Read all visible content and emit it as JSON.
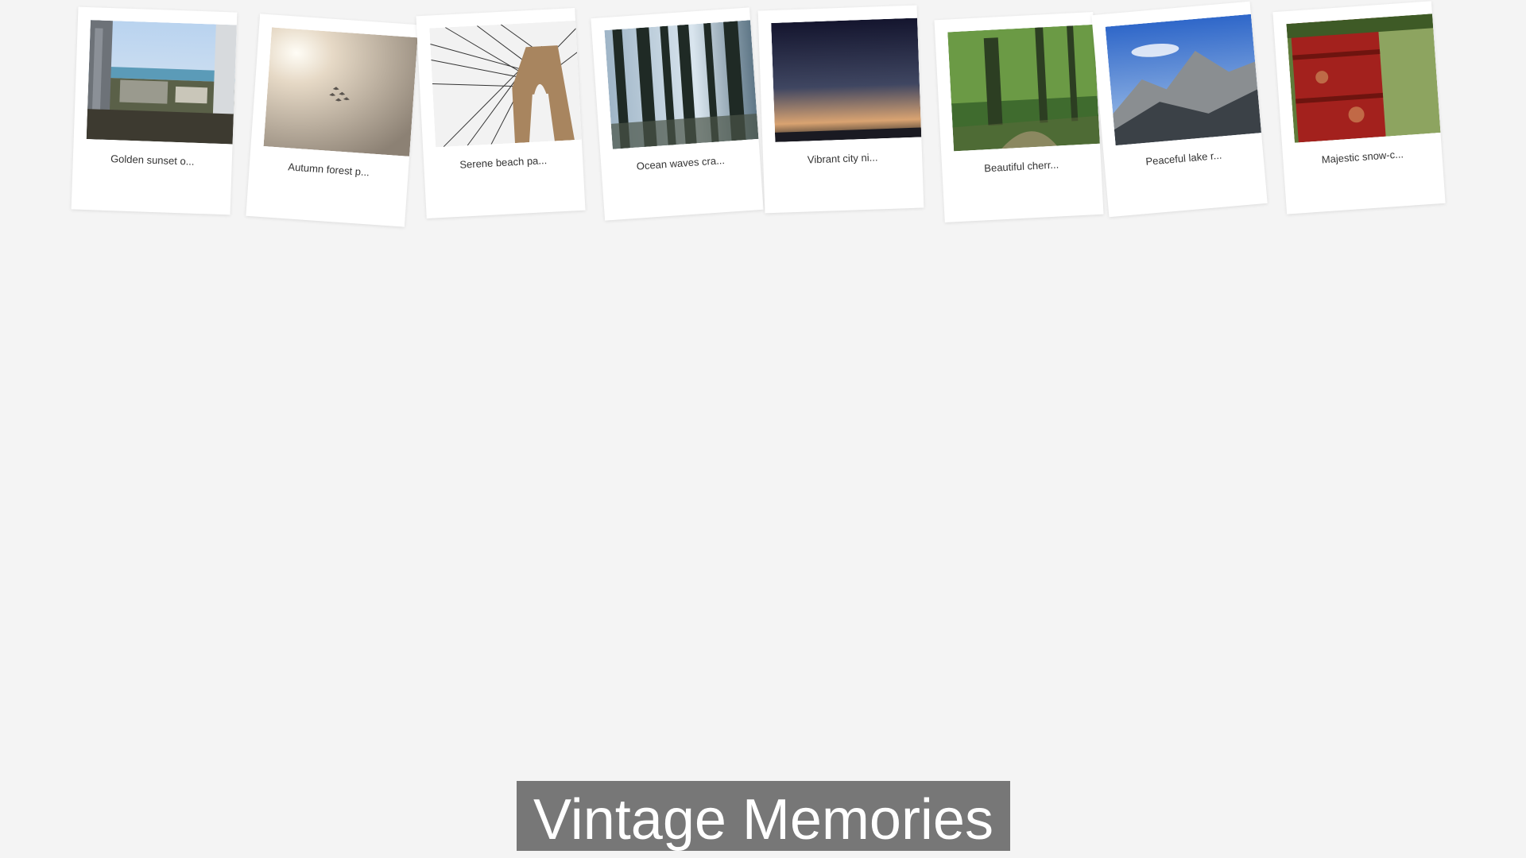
{
  "title": "Vintage Memories",
  "photos": [
    {
      "caption": "Golden sunset o...",
      "icon": "city-seaview-photo"
    },
    {
      "caption": "Autumn forest p...",
      "icon": "hazy-sky-photo"
    },
    {
      "caption": "Serene beach pa...",
      "icon": "bridge-cables-photo"
    },
    {
      "caption": "Ocean waves cra...",
      "icon": "tall-forest-photo"
    },
    {
      "caption": "Vibrant city ni...",
      "icon": "dusk-horizon-photo"
    },
    {
      "caption": "Beautiful cherr...",
      "icon": "forest-path-photo"
    },
    {
      "caption": "Peaceful lake r...",
      "icon": "mountain-photo"
    },
    {
      "caption": "Majestic snow-c...",
      "icon": "red-barrel-photo"
    }
  ],
  "colors": {
    "background": "#f4f4f4",
    "card": "#ffffff",
    "banner": "#777777",
    "banner_text": "#ffffff"
  }
}
